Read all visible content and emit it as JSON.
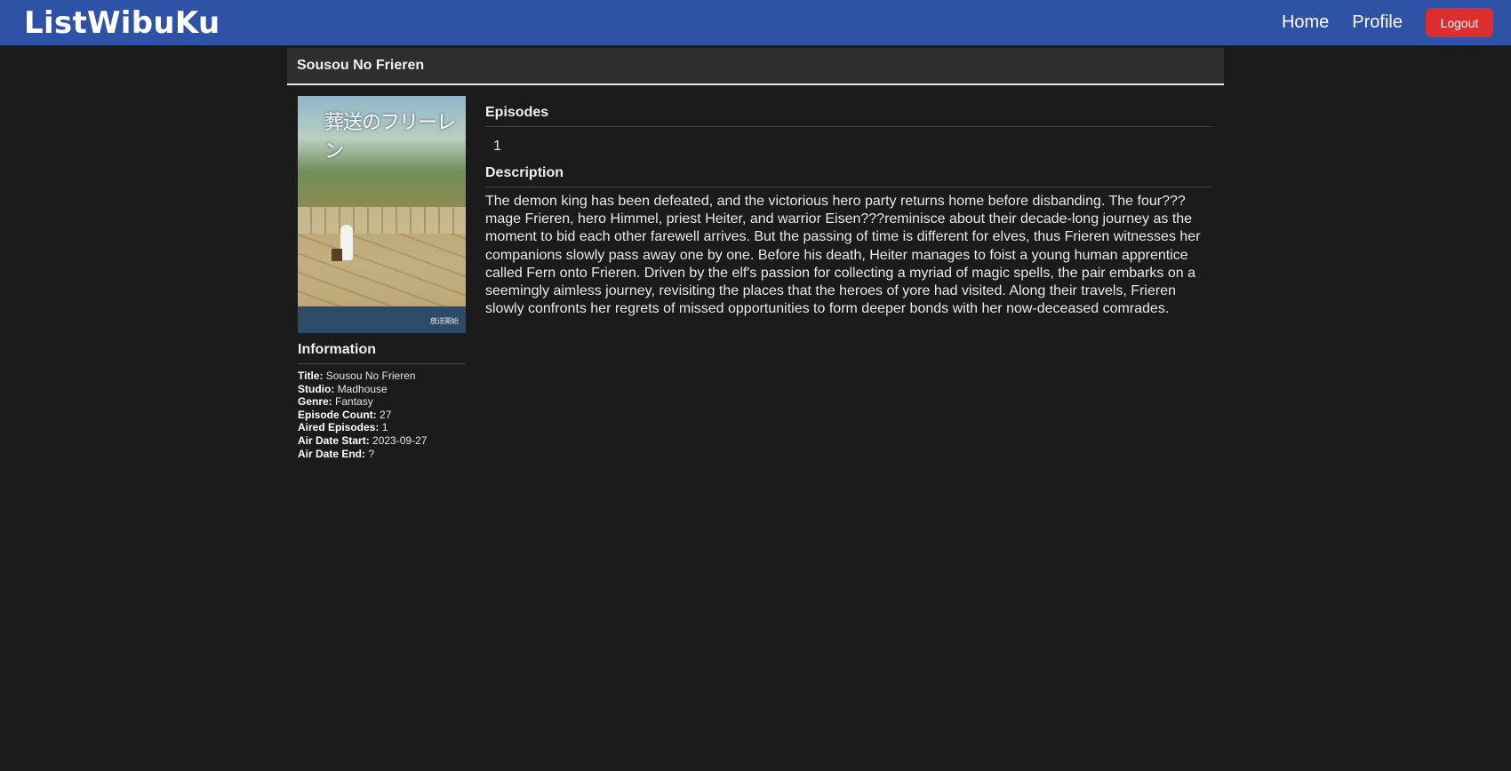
{
  "navbar": {
    "brand": "ListWibuKu",
    "links": [
      "Home",
      "Profile"
    ],
    "logout_label": "Logout",
    "background": "#2d52a6",
    "logout_color": "#dc2e2e"
  },
  "anime": {
    "title": "Sousou No Frieren",
    "poster": {
      "title_text": "葬送のフリーレン",
      "footer_text": "放送開始"
    },
    "information_heading": "Information",
    "info": [
      {
        "label": "Title:",
        "value": "Sousou No Frieren"
      },
      {
        "label": "Studio:",
        "value": "Madhouse"
      },
      {
        "label": "Genre:",
        "value": "Fantasy"
      },
      {
        "label": "Episode Count:",
        "value": "27"
      },
      {
        "label": "Aired Episodes:",
        "value": "1"
      },
      {
        "label": "Air Date Start:",
        "value": "2023-09-27"
      },
      {
        "label": "Air Date End:",
        "value": "?"
      }
    ],
    "episodes_heading": "Episodes",
    "episodes": [
      "1"
    ],
    "description_heading": "Description",
    "description": "The demon king has been defeated, and the victorious hero party returns home before disbanding. The four??? mage Frieren, hero Himmel, priest Heiter, and warrior Eisen???reminisce about their decade-long journey as the moment to bid each other farewell arrives. But the passing of time is different for elves, thus Frieren witnesses her companions slowly pass away one by one. Before his death, Heiter manages to foist a young human apprentice called Fern onto Frieren. Driven by the elf's passion for collecting a myriad of magic spells, the pair embarks on a seemingly aimless journey, revisiting the places that the heroes of yore had visited. Along their travels, Frieren slowly confronts her regrets of missed opportunities to form deeper bonds with her now-deceased comrades."
  }
}
